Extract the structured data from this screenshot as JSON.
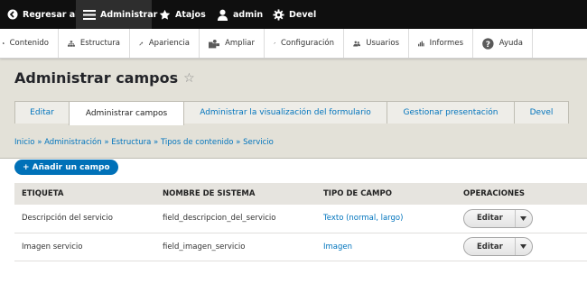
{
  "toolbar": {
    "back_label": "Regresar al sitio",
    "manage_label": "Administrar",
    "shortcuts_label": "Atajos",
    "user_label": "admin",
    "devel_label": "Devel"
  },
  "tray": {
    "items": [
      {
        "label": "Contenido",
        "icon": "content-icon"
      },
      {
        "label": "Estructura",
        "icon": "structure-icon"
      },
      {
        "label": "Apariencia",
        "icon": "appearance-icon"
      },
      {
        "label": "Ampliar",
        "icon": "extend-icon"
      },
      {
        "label": "Configuración",
        "icon": "config-icon"
      },
      {
        "label": "Usuarios",
        "icon": "people-icon"
      },
      {
        "label": "Informes",
        "icon": "reports-icon"
      },
      {
        "label": "Ayuda",
        "icon": "help-icon"
      }
    ]
  },
  "page": {
    "title": "Administrar campos",
    "star": "☆"
  },
  "tabs": [
    {
      "label": "Editar"
    },
    {
      "label": "Administrar campos",
      "active": true
    },
    {
      "label": "Administrar la visualización del formulario"
    },
    {
      "label": "Gestionar presentación"
    },
    {
      "label": "Devel"
    }
  ],
  "breadcrumb": "Inicio » Administración » Estructura » Tipos de contenido » Servicio",
  "add_button": "+ Añadir un campo",
  "table": {
    "headers": [
      "ETIQUETA",
      "NOMBRE DE SISTEMA",
      "TIPO DE CAMPO",
      "OPERACIONES"
    ],
    "rows": [
      {
        "label": "Descripción del servicio",
        "machine_name": "field_descripcion_del_servicio",
        "type": "Texto (normal, largo)",
        "operation": "Editar"
      },
      {
        "label": "Imagen servicio",
        "machine_name": "field_imagen_servicio",
        "type": "Imagen",
        "operation": "Editar"
      }
    ]
  },
  "colors": {
    "toolbar_bg": "#0f0f0f",
    "header_bg": "#e3e1d8",
    "link": "#0074bd",
    "primary_button": "#0071b8"
  }
}
